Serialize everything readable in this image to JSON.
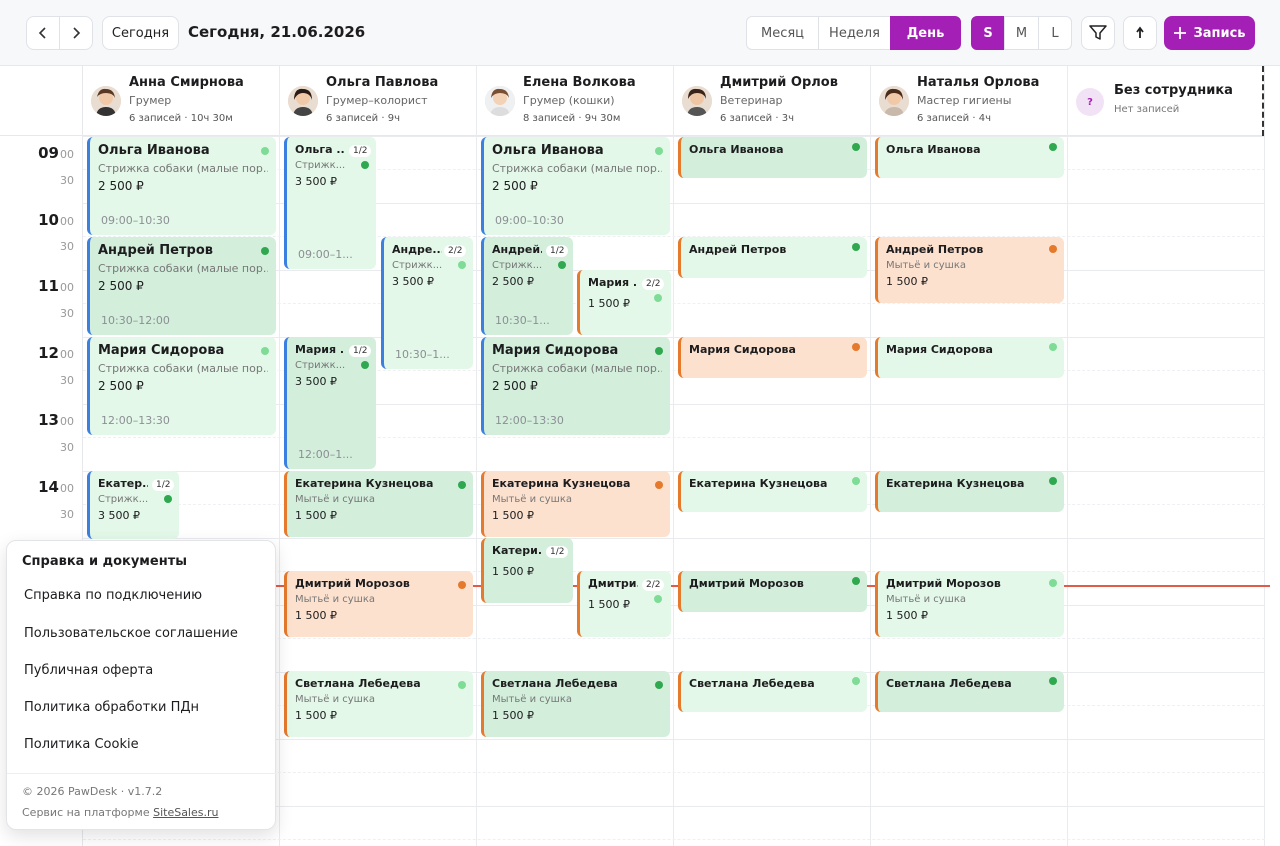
{
  "toolbar": {
    "today_label": "Сегодня",
    "title": "Сегодня, 21.06.2026",
    "views": [
      "Месяц",
      "Неделя",
      "День"
    ],
    "active_view": "День",
    "sizes": [
      "S",
      "M",
      "L"
    ],
    "active_size": "S",
    "add_label": "Запись",
    "accent": "#a41fb5"
  },
  "employees": [
    {
      "name": "Анна Смирнова",
      "role": "Грумер",
      "meta": "6 записей · 10ч 30м"
    },
    {
      "name": "Ольга Павлова",
      "role": "Грумер–колорист",
      "meta": "6 записей · 9ч"
    },
    {
      "name": "Елена Волкова",
      "role": "Грумер (кошки)",
      "meta": "8 записей · 9ч 30м"
    },
    {
      "name": "Дмитрий Орлов",
      "role": "Ветеринар",
      "meta": "6 записей · 3ч"
    },
    {
      "name": "Наталья Орлова",
      "role": "Мастер гигиены",
      "meta": "6 записей · 4ч"
    },
    {
      "name": "Без сотрудника",
      "role": "Нет записей",
      "mark": "?"
    }
  ],
  "times": {
    "h09": "09",
    "h10": "10",
    "h11": "11",
    "h12": "12",
    "h13": "13",
    "h14": "14",
    "m00": "00",
    "m30": "30"
  },
  "events": {
    "a1": {
      "name": "Ольга Иванова",
      "service": "Стрижка собаки (малые пор...",
      "price": "2 500 ₽",
      "time": "09:00–10:30"
    },
    "a2": {
      "name": "Андрей Петров",
      "service": "Стрижка собаки (малые пор...",
      "price": "2 500 ₽",
      "time": "10:30–12:00"
    },
    "a3": {
      "name": "Мария Сидорова",
      "service": "Стрижка собаки (малые пор...",
      "price": "2 500 ₽",
      "time": "12:00–13:30"
    },
    "a4": {
      "name": "Екатер...",
      "badge": "1/2",
      "service": "Стрижк...",
      "price": "3 500 ₽"
    },
    "o1": {
      "name": "Ольга ...",
      "badge": "1/2",
      "service": "Стрижк...",
      "price": "3 500 ₽",
      "time": "09:00–1..."
    },
    "o2": {
      "name": "Андре...",
      "badge": "2/2",
      "service": "Стрижк...",
      "price": "3 500 ₽",
      "time": "10:30–1..."
    },
    "o3": {
      "name": "Мария ...",
      "badge": "1/2",
      "service": "Стрижк...",
      "price": "3 500 ₽",
      "time": "12:00–1..."
    },
    "o4": {
      "name": "Екатерина Кузнецова",
      "service": "Мытьё и сушка",
      "price": "1 500 ₽"
    },
    "o5": {
      "name": "Дмитрий Морозов",
      "service": "Мытьё и сушка",
      "price": "1 500 ₽"
    },
    "o6": {
      "name": "Светлана Лебедева",
      "service": "Мытьё и сушка",
      "price": "1 500 ₽"
    },
    "e1": {
      "name": "Ольга Иванова",
      "service": "Стрижка собаки (малые пор...",
      "price": "2 500 ₽",
      "time": "09:00–10:30"
    },
    "e2": {
      "name": "Андрей...",
      "badge": "1/2",
      "service": "Стрижк...",
      "price": "2 500 ₽",
      "time": "10:30–1..."
    },
    "e3": {
      "name": "Мария ...",
      "badge": "2/2",
      "price": "1 500 ₽"
    },
    "e4": {
      "name": "Мария Сидорова",
      "service": "Стрижка собаки (малые пор...",
      "price": "2 500 ₽",
      "time": "12:00–13:30"
    },
    "e5": {
      "name": "Екатерина Кузнецова",
      "service": "Мытьё и сушка",
      "price": "1 500 ₽"
    },
    "e6": {
      "name": "Катери...",
      "badge": "1/2",
      "price": "1 500 ₽"
    },
    "e7": {
      "name": "Дмитри...",
      "badge": "2/2",
      "price": "1 500 ₽"
    },
    "e8": {
      "name": "Светлана Лебедева",
      "service": "Мытьё и сушка",
      "price": "1 500 ₽"
    },
    "d1": {
      "name": "Ольга Иванова"
    },
    "d2": {
      "name": "Андрей Петров"
    },
    "d3": {
      "name": "Мария Сидорова"
    },
    "d4": {
      "name": "Екатерина Кузнецова"
    },
    "d5": {
      "name": "Дмитрий Морозов"
    },
    "d6": {
      "name": "Светлана Лебедева"
    },
    "n1": {
      "name": "Ольга Иванова"
    },
    "n2": {
      "name": "Андрей Петров",
      "service": "Мытьё и сушка",
      "price": "1 500 ₽"
    },
    "n3": {
      "name": "Мария Сидорова"
    },
    "n4": {
      "name": "Екатерина Кузнецова"
    },
    "n5": {
      "name": "Дмитрий Морозов",
      "service": "Мытьё и сушка",
      "price": "1 500 ₽"
    },
    "n6": {
      "name": "Светлана Лебедева"
    }
  },
  "help": {
    "title": "Справка и документы",
    "items": [
      "Справка по подключению",
      "Пользовательское соглашение",
      "Публичная оферта",
      "Политика обработки ПДн",
      "Политика Cookie"
    ],
    "copyright": "© 2026 PawDesk · v1.7.2",
    "platform_text": "Сервис на платформе",
    "platform_link": "SiteSales.ru"
  }
}
